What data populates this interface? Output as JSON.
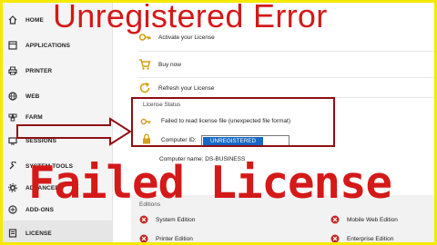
{
  "overlay": {
    "title": "Unregistered Error",
    "banner": "Failed License"
  },
  "sidebar": {
    "items": [
      {
        "label": "HOME",
        "icon": "home-icon"
      },
      {
        "label": "APPLICATIONS",
        "icon": "applications-icon"
      },
      {
        "label": "PRINTER",
        "icon": "printer-icon"
      },
      {
        "label": "WEB",
        "icon": "web-icon"
      },
      {
        "label": "FARM",
        "icon": "farm-icon"
      },
      {
        "label": "SESSIONS",
        "icon": "sessions-icon"
      },
      {
        "label": "SYSTEM TOOLS",
        "icon": "system-tools-icon"
      },
      {
        "label": "ADVANCED",
        "icon": "advanced-icon"
      },
      {
        "label": "ADD-ONS",
        "icon": "add-ons-icon"
      },
      {
        "label": "LICENSE",
        "icon": "license-icon",
        "active": true
      }
    ]
  },
  "actions": {
    "activate": "Activate your License",
    "buy": "Buy now",
    "refresh": "Refresh your License"
  },
  "license_status": {
    "header": "License Status",
    "message": "Failed to read license file (unexpected file format)",
    "computer_id_label": "Computer ID:",
    "computer_id_value": "UNREGISTERED",
    "computer_name": "Computer name: DS-BUSINESS"
  },
  "editions": {
    "header": "Editions",
    "items": [
      "System Edition",
      "Printer Edition",
      "Mobile Web Edition",
      "Enterprise Edition"
    ]
  },
  "colors": {
    "frame": "#f5e900",
    "overlay_red": "#d41919",
    "box_red": "#8e0f12",
    "selection_blue": "#1569c7",
    "icon_gold": "#d4a017"
  }
}
